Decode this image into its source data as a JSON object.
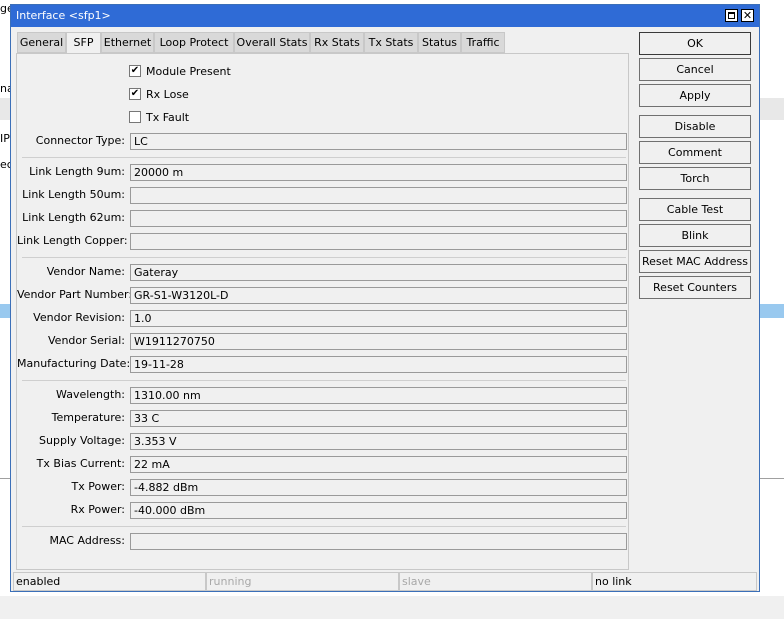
{
  "background": {
    "fragments": [
      "ge",
      "na",
      "IP",
      "ec"
    ]
  },
  "window": {
    "title": "Interface <sfp1>",
    "icons": [
      "restore-icon",
      "close-icon"
    ],
    "close_glyph": "✕"
  },
  "tabs": [
    "General",
    "SFP",
    "Ethernet",
    "Loop Protect",
    "Overall Stats",
    "Rx Stats",
    "Tx Stats",
    "Status",
    "Traffic"
  ],
  "active_tab": "SFP",
  "sfp": {
    "checks": [
      {
        "label": "Module Present",
        "checked": true
      },
      {
        "label": "Rx Lose",
        "checked": true
      },
      {
        "label": "Tx Fault",
        "checked": false
      }
    ],
    "fields": [
      {
        "label": "Connector Type:",
        "value": "LC"
      },
      {
        "label": "Link Length 9um:",
        "value": "20000 m"
      },
      {
        "label": "Link Length 50um:",
        "value": ""
      },
      {
        "label": "Link Length 62um:",
        "value": ""
      },
      {
        "label": "Link Length Copper:",
        "value": ""
      },
      {
        "label": "Vendor Name:",
        "value": "Gateray"
      },
      {
        "label": "Vendor Part Number:",
        "value": "GR-S1-W3120L-D"
      },
      {
        "label": "Vendor Revision:",
        "value": "1.0"
      },
      {
        "label": "Vendor Serial:",
        "value": "W1911270750"
      },
      {
        "label": "Manufacturing Date:",
        "value": "19-11-28"
      },
      {
        "label": "Wavelength:",
        "value": "1310.00 nm"
      },
      {
        "label": "Temperature:",
        "value": "33 C"
      },
      {
        "label": "Supply Voltage:",
        "value": "3.353 V"
      },
      {
        "label": "Tx Bias Current:",
        "value": "22 mA"
      },
      {
        "label": "Tx Power:",
        "value": "-4.882 dBm"
      },
      {
        "label": "Rx Power:",
        "value": "-40.000 dBm"
      },
      {
        "label": "MAC Address:",
        "value": ""
      }
    ]
  },
  "buttons": [
    "OK",
    "Cancel",
    "Apply",
    "Disable",
    "Comment",
    "Torch",
    "Cable Test",
    "Blink",
    "Reset MAC Address",
    "Reset Counters"
  ],
  "status_bar": [
    "enabled",
    "running",
    "slave",
    "no link"
  ],
  "check_glyph": "✔"
}
